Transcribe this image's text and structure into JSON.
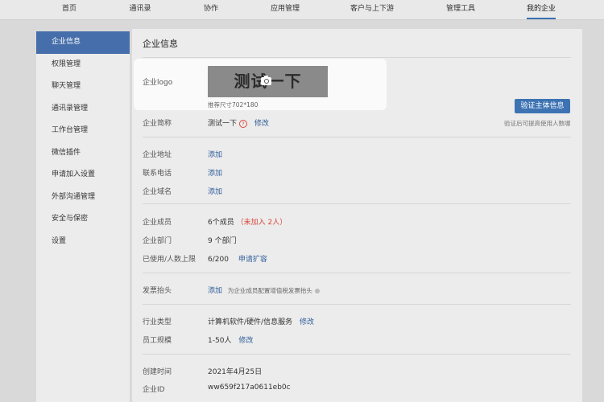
{
  "topnav": {
    "items": [
      "首页",
      "通讯录",
      "协作",
      "应用管理",
      "客户与上下游",
      "管理工具",
      "我的企业"
    ],
    "active_index": 6
  },
  "sidebar": {
    "items": [
      "企业信息",
      "权限管理",
      "聊天管理",
      "通讯录管理",
      "工作台管理",
      "微信插件",
      "申请加入设置",
      "外部沟通管理",
      "安全与保密",
      "设置"
    ],
    "active_index": 0
  },
  "main": {
    "title": "企业信息",
    "logo": {
      "label": "企业logo",
      "image_text": "测试一下",
      "size_hint": "推荐尺寸702*180"
    },
    "verify": {
      "button": "验证主体信息",
      "hint": "验证后可提高使用人数哪"
    },
    "short_name": {
      "label": "企业简称",
      "value": "测试一下",
      "help": "?",
      "action": "修改"
    },
    "address": {
      "label": "企业地址",
      "action": "添加"
    },
    "phone": {
      "label": "联系电话",
      "action": "添加"
    },
    "domain": {
      "label": "企业域名",
      "action": "添加"
    },
    "members": {
      "label": "企业成员",
      "value": "6个成员",
      "not_joined": "（未加入 2人）"
    },
    "departments": {
      "label": "企业部门",
      "value": "9 个部门"
    },
    "usage": {
      "label": "已使用/人数上限",
      "value": "6/200",
      "action": "申请扩容"
    },
    "invoice": {
      "label": "发票抬头",
      "action": "添加",
      "hint": "为企业成员配置增值税发票抬头"
    },
    "industry": {
      "label": "行业类型",
      "value": "计算机软件/硬件/信息服务",
      "action": "修改"
    },
    "staff_size": {
      "label": "员工规模",
      "value": "1-50人",
      "action": "修改"
    },
    "created": {
      "label": "创建时间",
      "value": "2021年4月25日"
    },
    "corp_id": {
      "label": "企业ID",
      "value": "ww659f217a0611eb0c"
    }
  },
  "colors": {
    "accent": "#3d73b3",
    "sidebar_active": "#456eaa",
    "warn": "#d9463b",
    "link": "#2f5d9a"
  }
}
